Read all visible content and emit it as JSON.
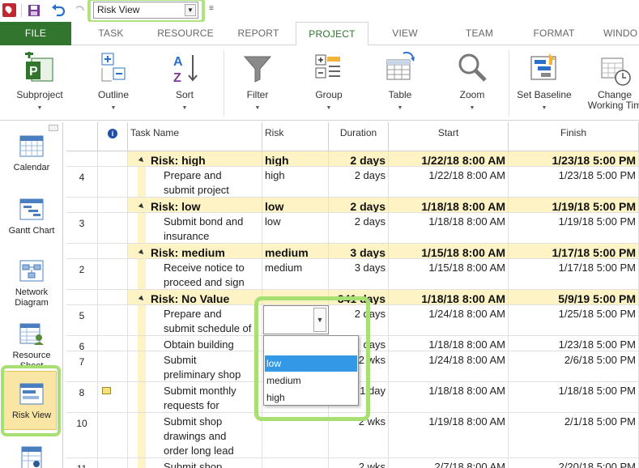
{
  "qat": {
    "view_selector_value": "Risk View",
    "customize_glyph": "≡"
  },
  "tabs": [
    {
      "label": "FILE"
    },
    {
      "label": "TASK"
    },
    {
      "label": "RESOURCE"
    },
    {
      "label": "REPORT"
    },
    {
      "label": "PROJECT"
    },
    {
      "label": "VIEW"
    },
    {
      "label": "TEAM"
    },
    {
      "label": "FORMAT"
    },
    {
      "label": "WINDO"
    }
  ],
  "ribbon": {
    "subproject": "Subproject",
    "outline": "Outline",
    "sort": "Sort",
    "filter": "Filter",
    "group": "Group",
    "table": "Table",
    "zoom": "Zoom",
    "set_baseline": "Set Baseline",
    "change_working_time_1": "Change",
    "change_working_time_2": "Working Tim"
  },
  "viewbar": {
    "calendar": "Calendar",
    "gantt_chart": "Gantt Chart",
    "network_1": "Network",
    "network_2": "Diagram",
    "resource_1": "Resource",
    "resource_2": "Sheet",
    "risk_view": "Risk View"
  },
  "grid": {
    "headers": {
      "info_icon": "i",
      "task_name": "Task Name",
      "risk": "Risk",
      "duration": "Duration",
      "start": "Start",
      "finish": "Finish"
    },
    "rows": [
      {
        "type": "group",
        "name": "Risk: high",
        "risk": "high",
        "duration": "2 days",
        "start": "1/22/18 8:00 AM",
        "finish": "1/23/18 5:00 PM"
      },
      {
        "type": "task",
        "id": "4",
        "name1": "Prepare and",
        "name2": "submit project",
        "risk": "high",
        "duration": "2 days",
        "start": "1/22/18 8:00 AM",
        "finish": "1/23/18 5:00 PM"
      },
      {
        "type": "group",
        "name": "Risk: low",
        "risk": "low",
        "duration": "2 days",
        "start": "1/18/18 8:00 AM",
        "finish": "1/19/18 5:00 PM"
      },
      {
        "type": "task",
        "id": "3",
        "name1": "Submit bond and",
        "name2": "insurance",
        "risk": "low",
        "duration": "2 days",
        "start": "1/18/18 8:00 AM",
        "finish": "1/19/18 5:00 PM"
      },
      {
        "type": "group",
        "name": "Risk: medium",
        "risk": "medium",
        "duration": "3 days",
        "start": "1/15/18 8:00 AM",
        "finish": "1/17/18 5:00 PM"
      },
      {
        "type": "task",
        "id": "2",
        "name1": "Receive notice to",
        "name2": "proceed and sign",
        "risk": "medium",
        "duration": "3 days",
        "start": "1/15/18 8:00 AM",
        "finish": "1/17/18 5:00 PM"
      },
      {
        "type": "group",
        "name": "Risk: No Value",
        "risk": "",
        "duration": "341 days",
        "start": "1/18/18 8:00 AM",
        "finish": "5/9/19 5:00 PM"
      },
      {
        "type": "task",
        "id": "5",
        "name1": "Prepare and",
        "name2": "submit schedule of",
        "risk": "",
        "duration": "2 days",
        "start": "1/24/18 8:00 AM",
        "finish": "1/25/18 5:00 PM"
      },
      {
        "type": "task",
        "id": "6",
        "name1": "Obtain building",
        "name2": "",
        "risk": "",
        "duration": "days",
        "start": "1/18/18 8:00 AM",
        "finish": "1/23/18 5:00 PM"
      },
      {
        "type": "task",
        "id": "7",
        "name1": "Submit",
        "name2": "preliminary shop",
        "risk": "",
        "duration": "2 wks",
        "start": "1/24/18 8:00 AM",
        "finish": "2/6/18 5:00 PM"
      },
      {
        "type": "task",
        "id": "8",
        "name1": "Submit monthly",
        "name2": "requests for",
        "risk": "",
        "duration": "1 day",
        "start": "1/18/18 8:00 AM",
        "finish": "1/18/18 5:00 PM"
      },
      {
        "type": "task",
        "id": "10",
        "name1": "Submit shop",
        "name2": "drawings and",
        "name3": "order long lead",
        "risk": "",
        "duration": "2 wks",
        "start": "1/19/18 8:00 AM",
        "finish": "2/1/18 5:00 PM"
      },
      {
        "type": "task",
        "id": "11",
        "name1": "Submit shop",
        "name2": "",
        "risk": "",
        "duration": "2 wks",
        "start": "2/7/18 8:00 AM",
        "finish": "2/20/18 5:00 PM"
      }
    ]
  },
  "risk_dropdown": {
    "value": "",
    "options": [
      "low",
      "medium",
      "high"
    ],
    "highlighted": "low"
  },
  "colors": {
    "file_tab": "#31752f",
    "group_row": "#fdf3c5",
    "annotation_highlight": "#a8df72",
    "selected_option": "#3399e6"
  }
}
